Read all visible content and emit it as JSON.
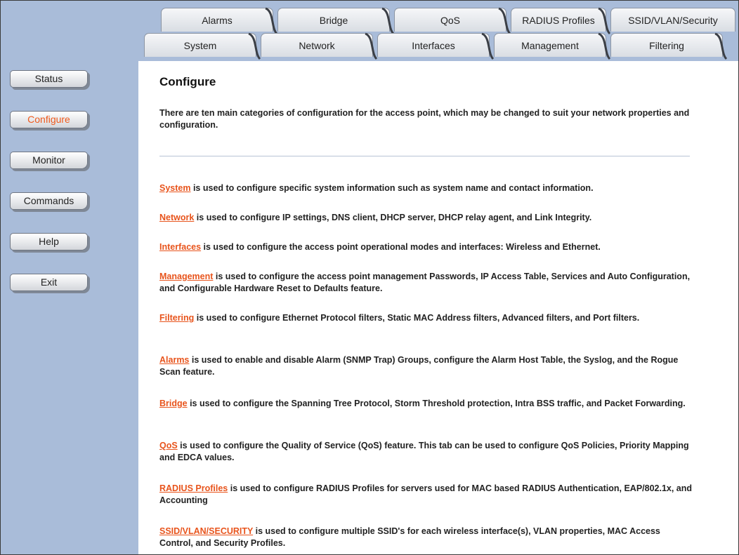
{
  "tabs": {
    "top": [
      {
        "label": "Alarms"
      },
      {
        "label": "Bridge"
      },
      {
        "label": "QoS"
      },
      {
        "label": "RADIUS Profiles"
      },
      {
        "label": "SSID/VLAN/Security"
      }
    ],
    "bottom": [
      {
        "label": "System"
      },
      {
        "label": "Network"
      },
      {
        "label": "Interfaces"
      },
      {
        "label": "Management"
      },
      {
        "label": "Filtering"
      }
    ]
  },
  "sidebar": {
    "buttons": [
      {
        "label": "Status"
      },
      {
        "label": "Configure"
      },
      {
        "label": "Monitor"
      },
      {
        "label": "Commands"
      },
      {
        "label": "Help"
      },
      {
        "label": "Exit"
      }
    ],
    "active": "Configure"
  },
  "main": {
    "title": "Configure",
    "intro": "There are ten main categories of configuration for the access point, which may be changed to suit your network properties and configuration.",
    "entries": [
      {
        "link": "System",
        "text": " is used to configure specific system information such as system name and contact information."
      },
      {
        "link": "Network",
        "text": " is used to configure IP settings, DNS client, DHCP server, DHCP relay agent, and Link Integrity."
      },
      {
        "link": "Interfaces",
        "text": " is used to configure the access point operational modes and interfaces: Wireless and Ethernet."
      },
      {
        "link": "Management",
        "text": " is used to configure the access point management Passwords, IP Access Table, Services and Auto Configuration, and Configurable Hardware Reset to Defaults feature."
      },
      {
        "link": "Filtering",
        "text": " is used to configure Ethernet Protocol filters, Static MAC Address filters, Advanced filters, and Port filters."
      },
      {
        "link": "Alarms",
        "text": " is used to enable and disable Alarm (SNMP Trap) Groups, configure the Alarm Host Table, the Syslog, and the Rogue Scan feature."
      },
      {
        "link": "Bridge",
        "text": " is used to configure the Spanning Tree Protocol, Storm Threshold protection, Intra BSS traffic, and Packet Forwarding."
      },
      {
        "link": "QoS",
        "text": " is used to configure the Quality of Service (QoS) feature. This tab can be used to configure QoS Policies, Priority Mapping and EDCA values."
      },
      {
        "link": "RADIUS Profiles",
        "text": " is used to configure RADIUS Profiles for servers used for MAC based RADIUS Authentication, EAP/802.1x, and Accounting"
      },
      {
        "link": "SSID/VLAN/SECURITY",
        "text": " is used to configure multiple SSID's for each wireless interface(s), VLAN properties, MAC Access Control, and Security Profiles."
      }
    ]
  },
  "colors": {
    "sidebar_bg": "#a9bcd9",
    "link": "#e8541c",
    "active_button_text": "#ef5a1d"
  }
}
